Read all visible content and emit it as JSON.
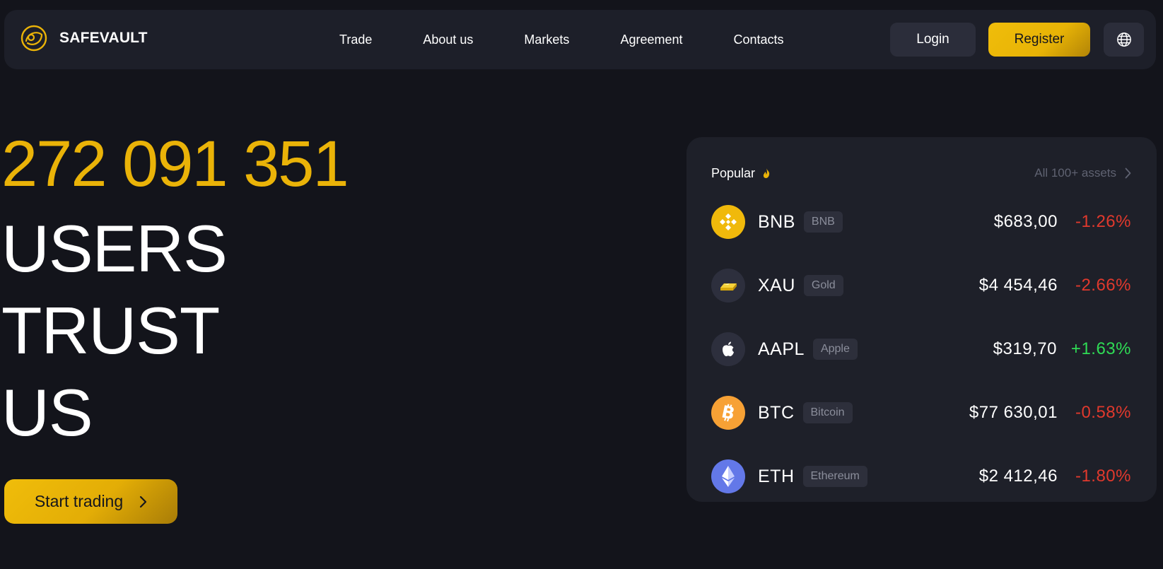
{
  "brand": {
    "name": "SAFEVAULT",
    "logo_icon": "vault-logo-icon",
    "accent": "#eab308"
  },
  "nav": {
    "links": [
      "Trade",
      "About us",
      "Markets",
      "Agreement",
      "Contacts"
    ],
    "login_label": "Login",
    "register_label": "Register",
    "language_icon": "globe-icon"
  },
  "hero": {
    "users_count": "272 091 351",
    "lines": [
      "USERS",
      "TRUST",
      "US"
    ],
    "cta_label": "Start trading"
  },
  "popular": {
    "title": "Popular",
    "title_icon": "fire-icon",
    "all_assets_label": "All 100+ assets",
    "assets": [
      {
        "symbol": "BNB",
        "name": "BNB",
        "price": "$683,00",
        "change": "-1.26%",
        "direction": "down",
        "icon": "bnb-icon",
        "icon_bg": "#f0b90b"
      },
      {
        "symbol": "XAU",
        "name": "Gold",
        "price": "$4 454,46",
        "change": "-2.66%",
        "direction": "down",
        "icon": "gold-bar-icon",
        "icon_bg": "#2d2f3d"
      },
      {
        "symbol": "AAPL",
        "name": "Apple",
        "price": "$319,70",
        "change": "+1.63%",
        "direction": "up",
        "icon": "apple-icon",
        "icon_bg": "#2d2f3d"
      },
      {
        "symbol": "BTC",
        "name": "Bitcoin",
        "price": "$77 630,01",
        "change": "-0.58%",
        "direction": "down",
        "icon": "bitcoin-icon",
        "icon_bg": "#f7a135"
      },
      {
        "symbol": "ETH",
        "name": "Ethereum",
        "price": "$2 412,46",
        "change": "-1.80%",
        "direction": "down",
        "icon": "ethereum-icon",
        "icon_bg": "#6378e8"
      }
    ]
  },
  "colors": {
    "background": "#13141b",
    "surface": "#1e2029",
    "positive": "#2fdb55",
    "negative": "#e0392d"
  }
}
